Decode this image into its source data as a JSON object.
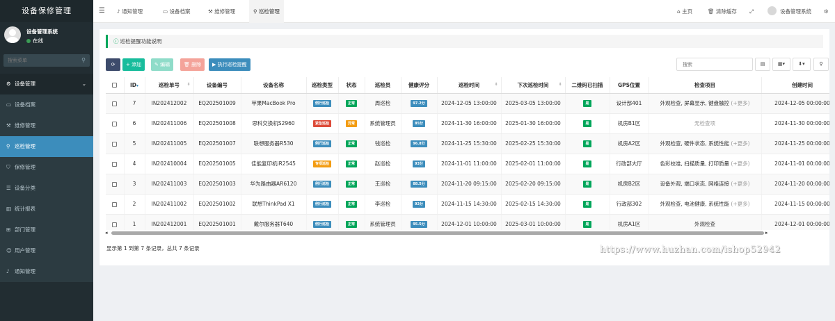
{
  "app": {
    "title": "设备保修管理"
  },
  "user": {
    "name": "设备管理系统",
    "status": "在线"
  },
  "sidebar": {
    "search_placeholder": "搜索菜单",
    "items": [
      {
        "label": "设备管理",
        "icon": "cogs-icon"
      },
      {
        "label": "设备档案",
        "icon": "laptop-icon"
      },
      {
        "label": "维修管理",
        "icon": "wrench-icon"
      },
      {
        "label": "巡检管理",
        "icon": "search-icon"
      },
      {
        "label": "保修管理",
        "icon": "shield-icon"
      },
      {
        "label": "设备分类",
        "icon": "list-icon"
      },
      {
        "label": "统计报表",
        "icon": "bar-chart-icon"
      },
      {
        "label": "部门管理",
        "icon": "sitemap-icon"
      },
      {
        "label": "用户管理",
        "icon": "users-icon"
      },
      {
        "label": "通知管理",
        "icon": "bell-icon"
      }
    ]
  },
  "header": {
    "tabs": [
      {
        "label": "通知管理",
        "icon": "bell-icon"
      },
      {
        "label": "设备档案",
        "icon": "laptop-icon"
      },
      {
        "label": "维修管理",
        "icon": "wrench-icon"
      },
      {
        "label": "巡检管理",
        "icon": "search-icon"
      }
    ],
    "home": "主页",
    "clear_cache": "清除缓存",
    "user": "设备管理系统"
  },
  "info": {
    "text": "巡检提醒功能说明"
  },
  "toolbar": {
    "add": "添加",
    "edit": "编辑",
    "delete": "删除",
    "run": "执行巡检提醒",
    "search_placeholder": "搜索"
  },
  "table": {
    "headers": [
      "ID",
      "巡检单号",
      "设备编号",
      "设备名称",
      "巡检类型",
      "状态",
      "巡检员",
      "健康评分",
      "巡检时间",
      "下次巡检时间",
      "二维码已扫描",
      "GPS位置",
      "检查项目",
      "创建时间"
    ],
    "rows": [
      {
        "id": "7",
        "no": "IN202412002",
        "dev_no": "EQ202501009",
        "name": "苹果MacBook Pro",
        "type": "例行巡检",
        "type_color": "#3c8dbc",
        "status": "正常",
        "status_color": "#00a65a",
        "inspector": "周巡检",
        "score": "97.2分",
        "time": "2024-12-05 13:00:00",
        "next": "2025-03-05 13:00:00",
        "qr": "是",
        "gps": "设计部401",
        "items": "外观检查, 屏幕显示, 键盘触控",
        "more": "(+更多)",
        "created": "2024-12-05 00:00:00"
      },
      {
        "id": "6",
        "no": "IN202411006",
        "dev_no": "EQ202501008",
        "name": "思科交换机S2960",
        "type": "紧急巡检",
        "type_color": "#dd4b39",
        "status": "异常",
        "status_color": "#f39c12",
        "inspector": "系统管理员",
        "score": "85分",
        "time": "2024-11-30 16:00:00",
        "next": "2025-01-30 16:00:00",
        "qr": "是",
        "gps": "机房B1区",
        "items": "无检查项",
        "more": "",
        "created": "2024-11-30 00:00:00"
      },
      {
        "id": "5",
        "no": "IN202411005",
        "dev_no": "EQ202501007",
        "name": "联想服务器R530",
        "type": "例行巡检",
        "type_color": "#3c8dbc",
        "status": "正常",
        "status_color": "#00a65a",
        "inspector": "钱巡检",
        "score": "96.8分",
        "time": "2024-11-25 15:30:00",
        "next": "2025-02-25 15:30:00",
        "qr": "是",
        "gps": "机房A2区",
        "items": "外观检查, 硬件状态, 系统性能",
        "more": "(+更多)",
        "created": "2024-11-25 00:00:00"
      },
      {
        "id": "4",
        "no": "IN202410004",
        "dev_no": "EQ202501005",
        "name": "佳能复印机iR2545",
        "type": "专项巡检",
        "type_color": "#f39c12",
        "status": "正常",
        "status_color": "#00a65a",
        "inspector": "赵巡检",
        "score": "93分",
        "time": "2024-11-01 11:00:00",
        "next": "2025-02-01 11:00:00",
        "qr": "是",
        "gps": "行政部大厅",
        "items": "色彩校准, 扫描质量, 打印质量",
        "more": "(+更多)",
        "created": "2024-11-01 00:00:00"
      },
      {
        "id": "3",
        "no": "IN202411003",
        "dev_no": "EQ202501003",
        "name": "华为路由器AR6120",
        "type": "例行巡检",
        "type_color": "#3c8dbc",
        "status": "正常",
        "status_color": "#00a65a",
        "inspector": "王巡检",
        "score": "88.5分",
        "time": "2024-11-20 09:15:00",
        "next": "2025-02-20 09:15:00",
        "qr": "是",
        "gps": "机房B2区",
        "items": "设备外观, 端口状态, 网络连接",
        "more": "(+更多)",
        "created": "2024-11-20 00:00:00"
      },
      {
        "id": "2",
        "no": "IN202411002",
        "dev_no": "EQ202501002",
        "name": "联想ThinkPad X1",
        "type": "例行巡检",
        "type_color": "#3c8dbc",
        "status": "正常",
        "status_color": "#00a65a",
        "inspector": "李巡检",
        "score": "92分",
        "time": "2024-11-15 14:30:00",
        "next": "2025-02-15 14:30:00",
        "qr": "是",
        "gps": "行政部302",
        "items": "外观检查, 电池健康, 系统性能",
        "more": "(+更多)",
        "created": "2024-11-15 00:00:00"
      },
      {
        "id": "1",
        "no": "IN202412001",
        "dev_no": "EQ202501001",
        "name": "戴尔服务器T640",
        "type": "例行巡检",
        "type_color": "#3c8dbc",
        "status": "正常",
        "status_color": "#00a65a",
        "inspector": "系统管理员",
        "score": "95.5分",
        "time": "2024-12-01 10:00:00",
        "next": "2025-03-01 10:00:00",
        "qr": "是",
        "gps": "机房A1区",
        "items": "外观检查",
        "more": "",
        "created": "2024-12-01 00:00:00"
      }
    ]
  },
  "pagination": {
    "summary": "显示第 1 到第 7 条记录，总共 7 条记录"
  },
  "watermark": "https://www.huzhan.com/ishop52942",
  "colors": {
    "sidebar_bg": "#222d32",
    "active": "#3c8dbc",
    "success": "#00a65a",
    "danger": "#dd4b39",
    "warning": "#f39c12",
    "info": "#00c0ef"
  }
}
